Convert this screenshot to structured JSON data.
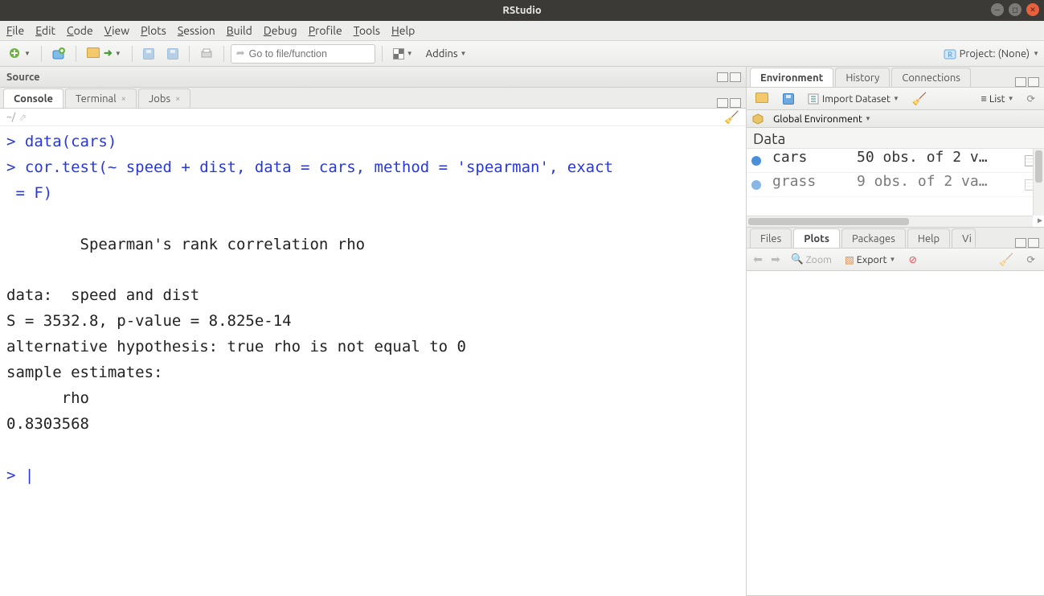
{
  "window": {
    "title": "RStudio"
  },
  "menu": [
    "File",
    "Edit",
    "Code",
    "View",
    "Plots",
    "Session",
    "Build",
    "Debug",
    "Profile",
    "Tools",
    "Help"
  ],
  "toolbar": {
    "goto_placeholder": "Go to file/function",
    "addins": "Addins",
    "project": "Project: (None)"
  },
  "source": {
    "title": "Source"
  },
  "left_tabs": {
    "console": "Console",
    "terminal": "Terminal",
    "jobs": "Jobs",
    "path": "~/"
  },
  "console_lines": [
    {
      "prompt": "> ",
      "text": "data(cars)",
      "class": "pr"
    },
    {
      "prompt": "> ",
      "text": "cor.test(~ speed + dist, data = cars, method = 'spearman', exact",
      "class": "pr"
    },
    {
      "prompt": "",
      "text": " = F)",
      "class": "pr"
    },
    {
      "prompt": "",
      "text": "",
      "class": ""
    },
    {
      "prompt": "",
      "text": "        Spearman's rank correlation rho",
      "class": ""
    },
    {
      "prompt": "",
      "text": "",
      "class": ""
    },
    {
      "prompt": "",
      "text": "data:  speed and dist",
      "class": ""
    },
    {
      "prompt": "",
      "text": "S = 3532.8, p-value = 8.825e-14",
      "class": ""
    },
    {
      "prompt": "",
      "text": "alternative hypothesis: true rho is not equal to 0",
      "class": ""
    },
    {
      "prompt": "",
      "text": "sample estimates:",
      "class": ""
    },
    {
      "prompt": "",
      "text": "      rho ",
      "class": ""
    },
    {
      "prompt": "",
      "text": "0.8303568 ",
      "class": ""
    },
    {
      "prompt": "",
      "text": "",
      "class": ""
    },
    {
      "prompt": "> ",
      "text": "|",
      "class": "pr"
    }
  ],
  "env_tabs": [
    "Environment",
    "History",
    "Connections"
  ],
  "env_toolbar": {
    "import": "Import Dataset",
    "list": "List"
  },
  "env_scope": "Global Environment",
  "env_section": "Data",
  "env_rows": [
    {
      "name": "cars",
      "value": "50 obs. of 2 v…"
    },
    {
      "name": "grass",
      "value": "9 obs. of 2 va…"
    }
  ],
  "plot_tabs": [
    "Files",
    "Plots",
    "Packages",
    "Help",
    "Vi"
  ],
  "plot_toolbar": {
    "zoom": "Zoom",
    "export": "Export"
  }
}
